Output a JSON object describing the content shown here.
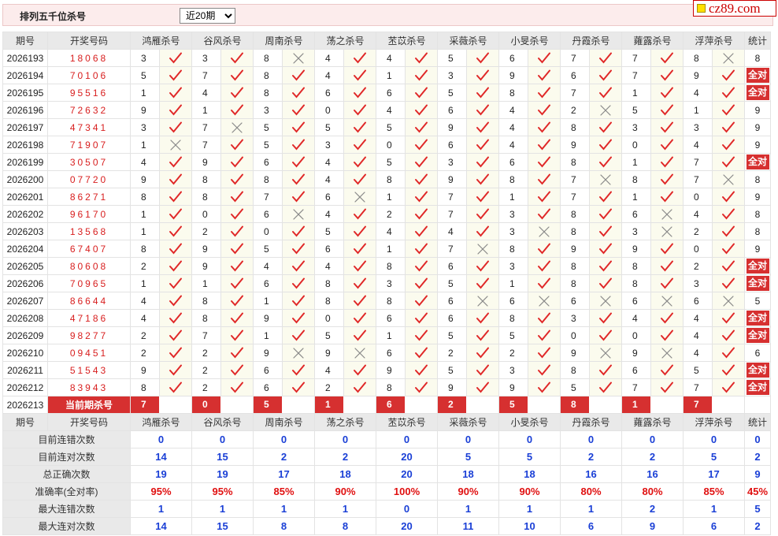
{
  "title": "排列五千位杀号",
  "period_select": "近20期",
  "logo": "cz89.com",
  "labels": {
    "issue": "期号",
    "number": "开奖号码",
    "total": "统计",
    "current": "当前期杀号",
    "all_correct": "全对"
  },
  "experts": [
    "鸿雁杀号",
    "谷风杀号",
    "周南杀号",
    "荡之杀号",
    "苤苡杀号",
    "采薇杀号",
    "小旻杀号",
    "丹霞杀号",
    "蕹露杀号",
    "浮萍杀号"
  ],
  "rows": [
    {
      "issue": "2026193",
      "number": "18068",
      "vals": [
        3,
        3,
        8,
        4,
        4,
        5,
        6,
        7,
        7,
        8
      ],
      "ok": [
        1,
        1,
        0,
        1,
        1,
        1,
        1,
        1,
        1,
        0
      ],
      "total": "8"
    },
    {
      "issue": "2026194",
      "number": "70106",
      "vals": [
        5,
        7,
        8,
        4,
        1,
        3,
        9,
        6,
        7,
        9
      ],
      "ok": [
        1,
        1,
        1,
        1,
        1,
        1,
        1,
        1,
        1,
        1
      ],
      "total": "全对"
    },
    {
      "issue": "2026195",
      "number": "95516",
      "vals": [
        1,
        4,
        8,
        6,
        6,
        5,
        8,
        7,
        1,
        4
      ],
      "ok": [
        1,
        1,
        1,
        1,
        1,
        1,
        1,
        1,
        1,
        1
      ],
      "total": "全对"
    },
    {
      "issue": "2026196",
      "number": "72632",
      "vals": [
        9,
        1,
        3,
        0,
        4,
        6,
        4,
        2,
        5,
        1
      ],
      "ok": [
        1,
        1,
        1,
        1,
        1,
        1,
        1,
        0,
        1,
        1
      ],
      "total": "9"
    },
    {
      "issue": "2026197",
      "number": "47341",
      "vals": [
        3,
        7,
        5,
        5,
        5,
        9,
        4,
        8,
        3,
        3
      ],
      "ok": [
        1,
        0,
        1,
        1,
        1,
        1,
        1,
        1,
        1,
        1
      ],
      "total": "9"
    },
    {
      "issue": "2026198",
      "number": "71907",
      "vals": [
        1,
        7,
        5,
        3,
        0,
        6,
        4,
        9,
        0,
        4
      ],
      "ok": [
        0,
        1,
        1,
        1,
        1,
        1,
        1,
        1,
        1,
        1
      ],
      "total": "9"
    },
    {
      "issue": "2026199",
      "number": "30507",
      "vals": [
        4,
        9,
        6,
        4,
        5,
        3,
        6,
        8,
        1,
        7
      ],
      "ok": [
        1,
        1,
        1,
        1,
        1,
        1,
        1,
        1,
        1,
        1
      ],
      "total": "全对"
    },
    {
      "issue": "2026200",
      "number": "07720",
      "vals": [
        9,
        8,
        8,
        4,
        8,
        9,
        8,
        7,
        8,
        7
      ],
      "ok": [
        1,
        1,
        1,
        1,
        1,
        1,
        1,
        0,
        1,
        0
      ],
      "total": "8"
    },
    {
      "issue": "2026201",
      "number": "86271",
      "vals": [
        8,
        8,
        7,
        6,
        1,
        7,
        1,
        7,
        1,
        0
      ],
      "ok": [
        1,
        1,
        1,
        0,
        1,
        1,
        1,
        1,
        1,
        1
      ],
      "total": "9"
    },
    {
      "issue": "2026202",
      "number": "96170",
      "vals": [
        1,
        0,
        6,
        4,
        2,
        7,
        3,
        8,
        6,
        4
      ],
      "ok": [
        1,
        1,
        0,
        1,
        1,
        1,
        1,
        1,
        0,
        1
      ],
      "total": "8"
    },
    {
      "issue": "2026203",
      "number": "13568",
      "vals": [
        1,
        2,
        0,
        5,
        4,
        4,
        3,
        8,
        3,
        2
      ],
      "ok": [
        1,
        1,
        1,
        1,
        1,
        1,
        0,
        1,
        0,
        1
      ],
      "total": "8"
    },
    {
      "issue": "2026204",
      "number": "67407",
      "vals": [
        8,
        9,
        5,
        6,
        1,
        7,
        8,
        9,
        9,
        0
      ],
      "ok": [
        1,
        1,
        1,
        1,
        1,
        0,
        1,
        1,
        1,
        1
      ],
      "total": "9"
    },
    {
      "issue": "2026205",
      "number": "80608",
      "vals": [
        2,
        9,
        4,
        4,
        8,
        6,
        3,
        8,
        8,
        2
      ],
      "ok": [
        1,
        1,
        1,
        1,
        1,
        1,
        1,
        1,
        1,
        1
      ],
      "total": "全对"
    },
    {
      "issue": "2026206",
      "number": "70965",
      "vals": [
        1,
        1,
        6,
        8,
        3,
        5,
        1,
        8,
        8,
        3
      ],
      "ok": [
        1,
        1,
        1,
        1,
        1,
        1,
        1,
        1,
        1,
        1
      ],
      "total": "全对"
    },
    {
      "issue": "2026207",
      "number": "86644",
      "vals": [
        4,
        8,
        1,
        8,
        8,
        6,
        6,
        6,
        6,
        6
      ],
      "ok": [
        1,
        1,
        1,
        1,
        1,
        0,
        0,
        0,
        0,
        0
      ],
      "total": "5"
    },
    {
      "issue": "2026208",
      "number": "47186",
      "vals": [
        4,
        8,
        9,
        0,
        6,
        6,
        8,
        3,
        4,
        4
      ],
      "ok": [
        1,
        1,
        1,
        1,
        1,
        1,
        1,
        1,
        1,
        1
      ],
      "total": "全对"
    },
    {
      "issue": "2026209",
      "number": "98277",
      "vals": [
        2,
        7,
        1,
        5,
        1,
        5,
        5,
        0,
        0,
        4
      ],
      "ok": [
        1,
        1,
        1,
        1,
        1,
        1,
        1,
        1,
        1,
        1
      ],
      "total": "全对"
    },
    {
      "issue": "2026210",
      "number": "09451",
      "vals": [
        2,
        2,
        9,
        9,
        6,
        2,
        2,
        9,
        9,
        4
      ],
      "ok": [
        1,
        1,
        0,
        0,
        1,
        1,
        1,
        0,
        0,
        1
      ],
      "total": "6"
    },
    {
      "issue": "2026211",
      "number": "51543",
      "vals": [
        9,
        2,
        6,
        4,
        9,
        5,
        3,
        8,
        6,
        5
      ],
      "ok": [
        1,
        1,
        1,
        1,
        1,
        1,
        1,
        1,
        1,
        1
      ],
      "total": "全对"
    },
    {
      "issue": "2026212",
      "number": "83943",
      "vals": [
        8,
        2,
        6,
        2,
        8,
        9,
        9,
        5,
        7,
        7
      ],
      "ok": [
        1,
        1,
        1,
        1,
        1,
        1,
        1,
        1,
        1,
        1
      ],
      "total": "全对"
    }
  ],
  "current": {
    "issue": "2026213",
    "vals": [
      "7",
      "0",
      "5",
      "1",
      "6",
      "2",
      "5",
      "8",
      "1",
      "7"
    ]
  },
  "stats": [
    {
      "label": "目前连错次数",
      "vals": [
        "0",
        "0",
        "0",
        "0",
        "0",
        "0",
        "0",
        "0",
        "0",
        "0"
      ],
      "total": "0",
      "color": "#1a3fd6"
    },
    {
      "label": "目前连对次数",
      "vals": [
        "14",
        "15",
        "2",
        "2",
        "20",
        "5",
        "5",
        "2",
        "2",
        "5"
      ],
      "total": "2",
      "color": "#1a3fd6"
    },
    {
      "label": "总正确次数",
      "vals": [
        "19",
        "19",
        "17",
        "18",
        "20",
        "18",
        "18",
        "16",
        "16",
        "17"
      ],
      "total": "9",
      "color": "#1a3fd6"
    },
    {
      "label": "准确率(全对率)",
      "vals": [
        "95%",
        "95%",
        "85%",
        "90%",
        "100%",
        "90%",
        "90%",
        "80%",
        "80%",
        "85%"
      ],
      "total": "45%",
      "color": "#e01010"
    },
    {
      "label": "最大连错次数",
      "vals": [
        "1",
        "1",
        "1",
        "1",
        "0",
        "1",
        "1",
        "1",
        "2",
        "1"
      ],
      "total": "5",
      "color": "#1a3fd6"
    },
    {
      "label": "最大连对次数",
      "vals": [
        "14",
        "15",
        "8",
        "8",
        "20",
        "11",
        "10",
        "6",
        "9",
        "6"
      ],
      "total": "2",
      "color": "#1a3fd6"
    }
  ],
  "colors": {
    "accent": "#d63030",
    "check": "#e02828",
    "cross": "#888888",
    "header_bg": "#e9e9e9",
    "mark_bg": "#fbfbee"
  }
}
